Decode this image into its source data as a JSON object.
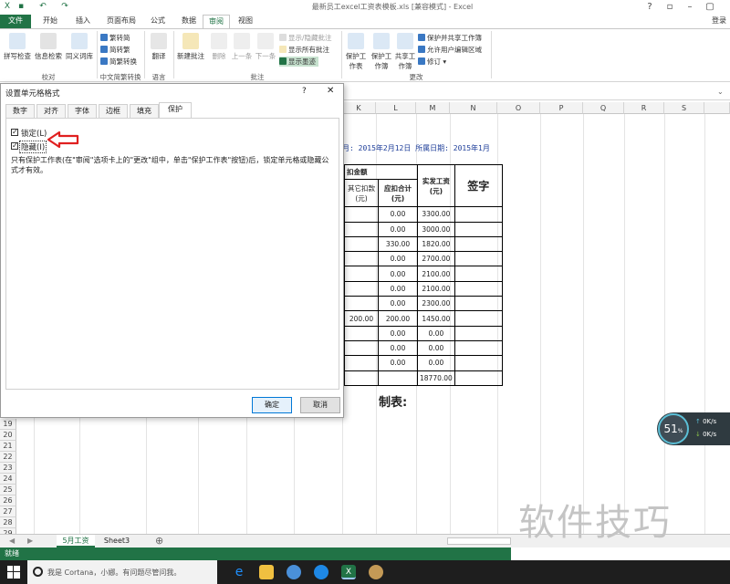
{
  "window": {
    "title": "最新员工excel工资表模板.xls  [兼容模式] - Excel",
    "login": "登录"
  },
  "menu": {
    "tabs": [
      "文件",
      "开始",
      "插入",
      "页面布局",
      "公式",
      "数据",
      "审阅",
      "视图"
    ],
    "active": "审阅"
  },
  "ribbon": {
    "proofing": {
      "label": "校对",
      "items": [
        "拼写检查",
        "信息检索",
        "同义词库"
      ]
    },
    "chinese": {
      "label": "中文简繁转换",
      "items": [
        "繁转简",
        "简转繁",
        "简繁转换"
      ]
    },
    "language": {
      "label": "语言",
      "items": [
        "翻译"
      ]
    },
    "comments": {
      "label": "批注",
      "items": [
        "新建批注",
        "删除",
        "上一条",
        "下一条"
      ],
      "small": [
        "显示/隐藏批注",
        "显示所有批注",
        "显示墨迹"
      ]
    },
    "changes": {
      "label": "更改",
      "items": [
        "保护工作表",
        "保护工作簿",
        "共享工作簿"
      ],
      "small": [
        "保护并共享工作簿",
        "允许用户编辑区域",
        "修订 ▾"
      ]
    }
  },
  "columns": [
    "K",
    "L",
    "M",
    "N",
    "O",
    "P",
    "Q",
    "R",
    "S"
  ],
  "rows": [
    "19",
    "20",
    "21",
    "22",
    "23",
    "24",
    "25",
    "26",
    "27",
    "28",
    "29"
  ],
  "sheet": {
    "date_line": "月: 2015年2月12日  所属日期: 2015年1月",
    "deduct_header": "扣金额",
    "headers": {
      "other": "其它扣款(元)",
      "total_deduct": "应扣合计(元)",
      "net": "实发工资(元)",
      "sign": "签字"
    },
    "rows": [
      [
        "",
        "0.00",
        "3300.00"
      ],
      [
        "",
        "0.00",
        "3000.00"
      ],
      [
        "",
        "330.00",
        "1820.00"
      ],
      [
        "",
        "0.00",
        "2700.00"
      ],
      [
        "",
        "0.00",
        "2100.00"
      ],
      [
        "",
        "0.00",
        "2100.00"
      ],
      [
        "",
        "0.00",
        "2300.00"
      ],
      [
        "200.00",
        "200.00",
        "1450.00"
      ],
      [
        "",
        "0.00",
        "0.00"
      ],
      [
        "",
        "0.00",
        "0.00"
      ],
      [
        "",
        "0.00",
        "0.00"
      ],
      [
        "",
        "",
        "18770.00"
      ]
    ],
    "maker": "制表:"
  },
  "dialog": {
    "title": "设置单元格格式",
    "help": "?",
    "tabs": [
      "数字",
      "对齐",
      "字体",
      "边框",
      "填充",
      "保护"
    ],
    "active_tab": "保护",
    "locked_label": "锁定(L)",
    "hidden_label": "隐藏(I)",
    "locked": true,
    "hidden": true,
    "note": "只有保护工作表(在\"审阅\"选项卡上的\"更改\"组中，单击\"保护工作表\"按钮)后，锁定单元格或隐藏公式才有效。",
    "ok": "确定",
    "cancel": "取消"
  },
  "sheet_tabs": [
    "5月工资",
    "Sheet3"
  ],
  "active_sheet": "5月工资",
  "status": "就绪",
  "widget": {
    "percent": "51",
    "up": "0K/s",
    "down": "0K/s"
  },
  "taskbar": {
    "search": "我是 Cortana，小娜。有问题尽管问我。"
  },
  "watermark": "软件技巧",
  "colors": {
    "excel_green": "#217346",
    "arrow_red": "#e02020"
  }
}
